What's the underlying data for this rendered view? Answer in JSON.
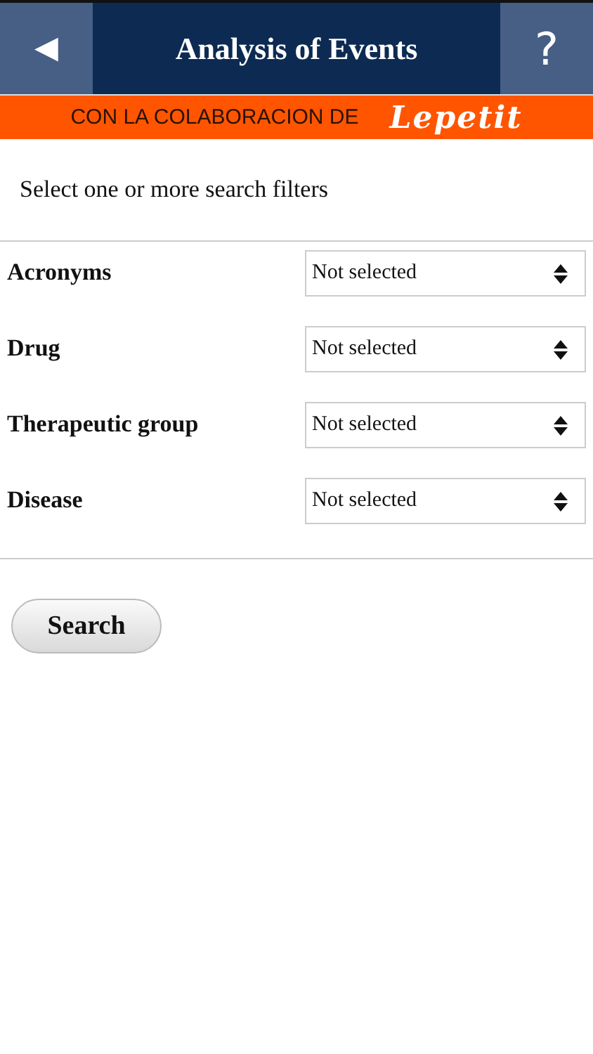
{
  "header": {
    "back": "◀",
    "title": "Analysis of Events",
    "help": "?"
  },
  "banner": {
    "text": "CON LA COLABORACION DE",
    "sponsor": "Lepetit"
  },
  "intro": "Select one or more search filters",
  "filters": [
    {
      "label": "Acronyms",
      "value": "Not selected"
    },
    {
      "label": "Drug",
      "value": "Not selected"
    },
    {
      "label": "Therapeutic group",
      "value": "Not selected"
    },
    {
      "label": "Disease",
      "value": "Not selected"
    }
  ],
  "search_button": "Search"
}
